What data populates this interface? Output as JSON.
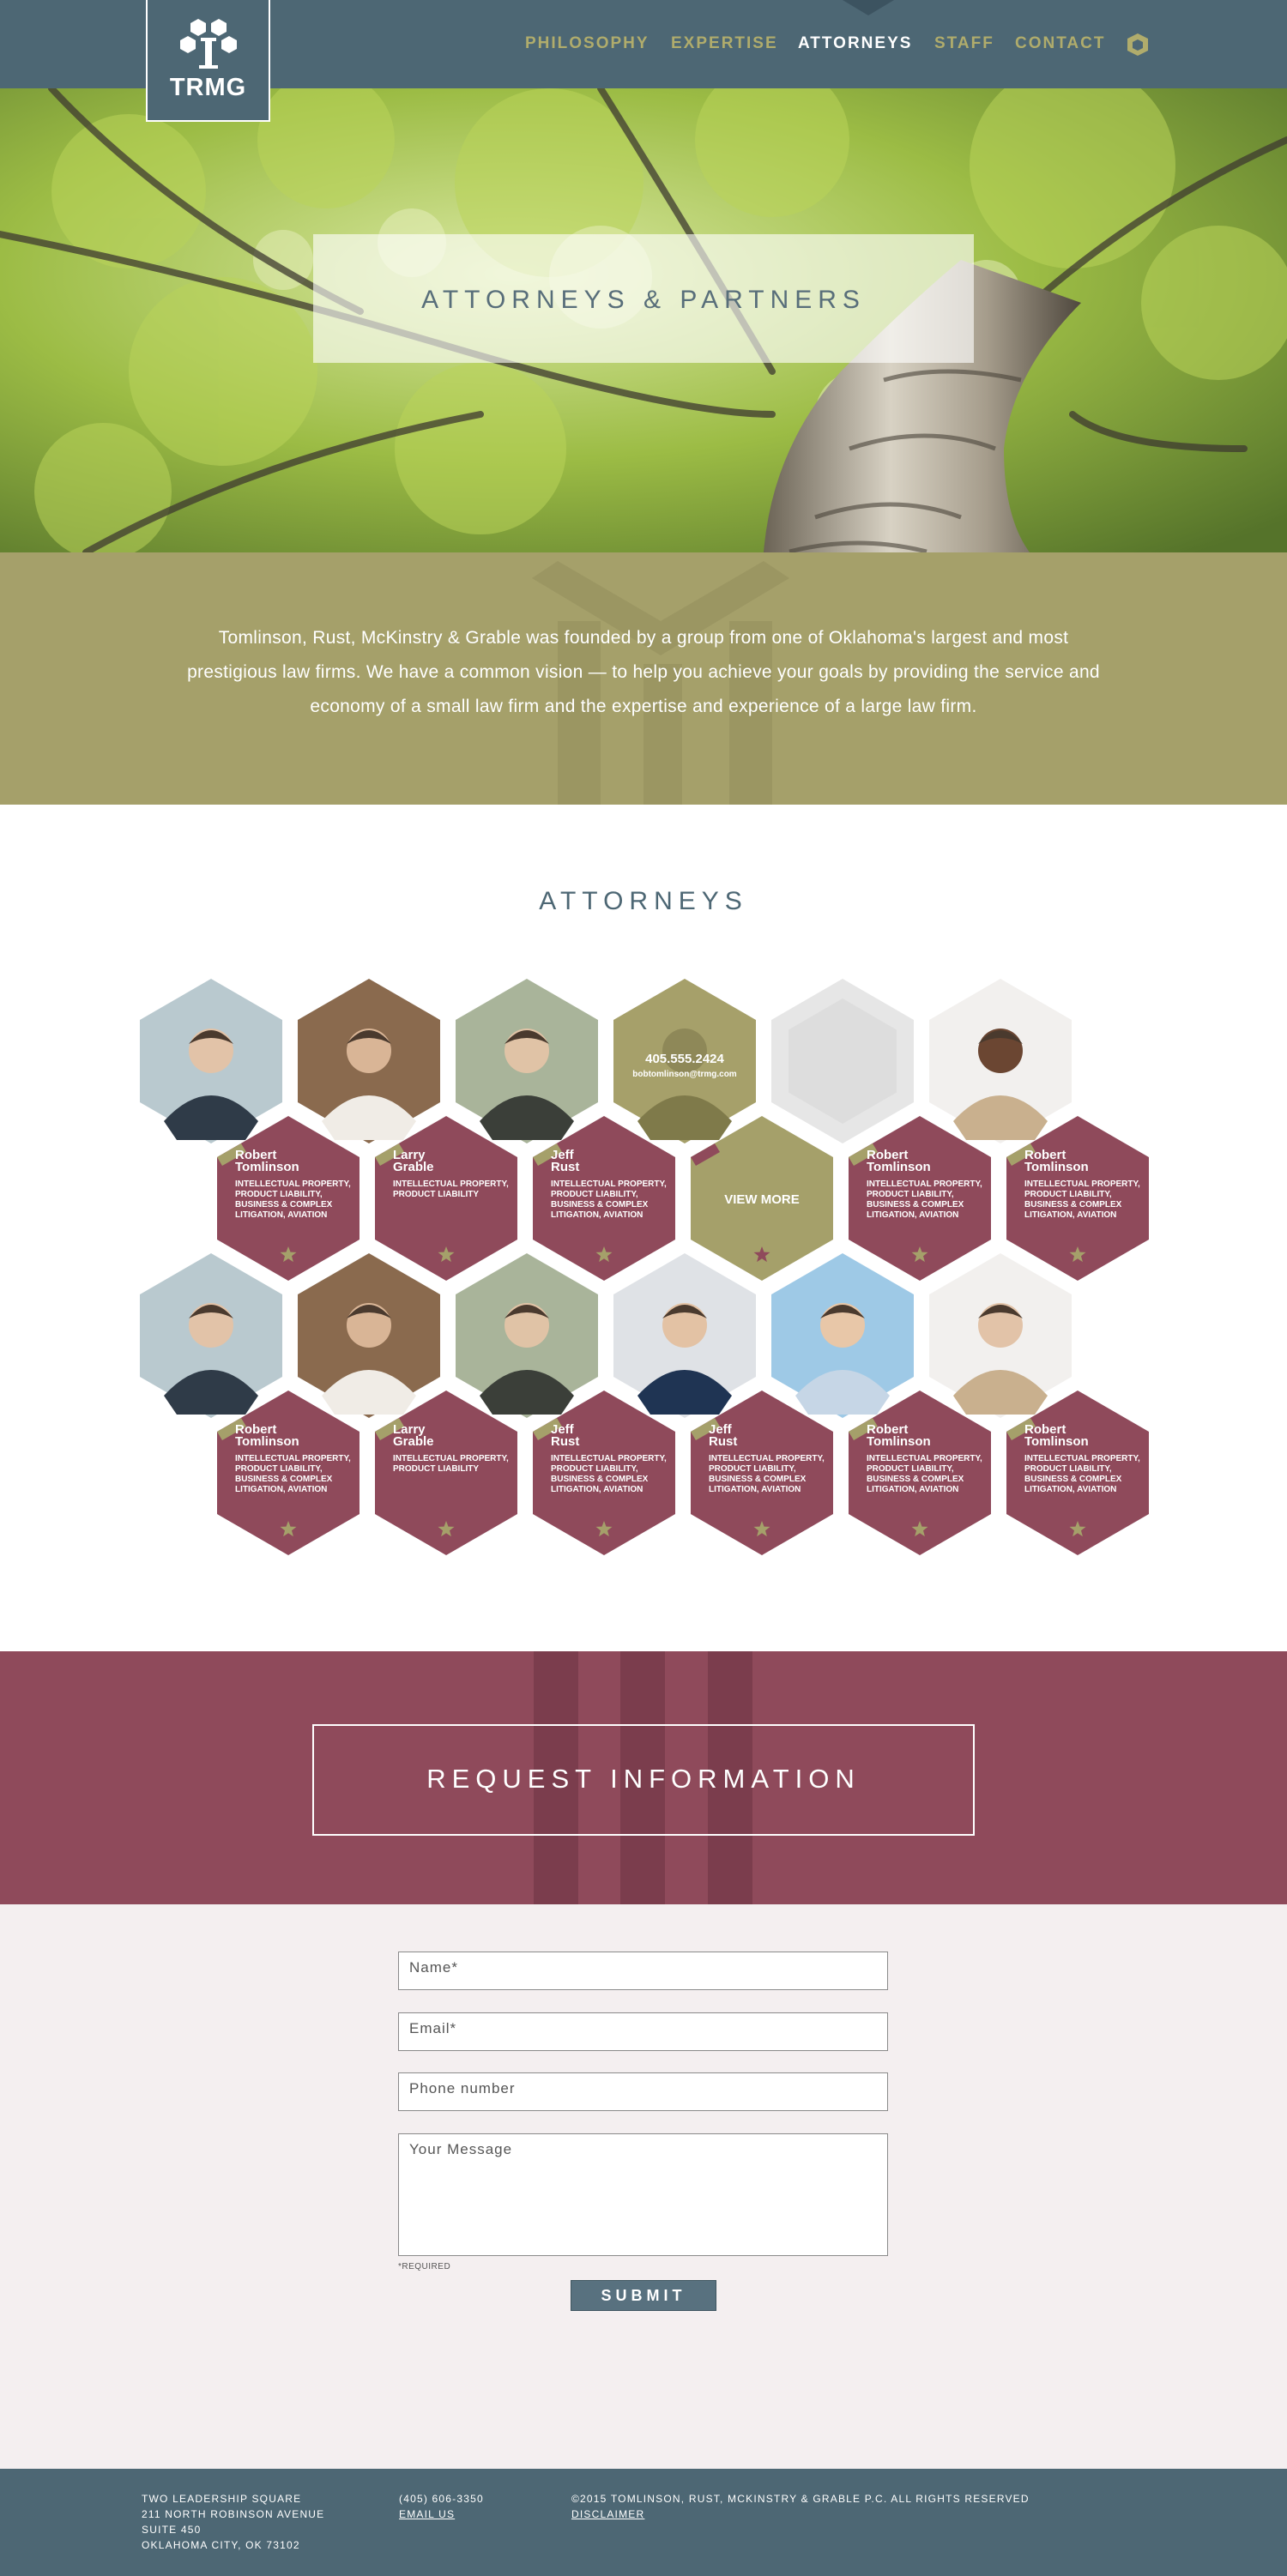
{
  "brand": {
    "logo_text": "TRMG"
  },
  "nav": {
    "items": [
      {
        "label": "PHILOSOPHY",
        "active": false
      },
      {
        "label": "EXPERTISE",
        "active": false
      },
      {
        "label": "ATTORNEYS",
        "active": true
      },
      {
        "label": "STAFF",
        "active": false
      },
      {
        "label": "CONTACT",
        "active": false
      }
    ],
    "icon": "shield-icon"
  },
  "hero": {
    "title": "ATTORNEYS & PARTNERS"
  },
  "intro": {
    "text": "Tomlinson, Rust, McKinstry & Grable was founded by a group from one of Oklahoma's largest and most prestigious law firms. We have a common vision — to help you achieve your goals by providing the service and economy of a small law firm and the expertise and experience of a large law firm."
  },
  "attorneys": {
    "title": "ATTORNEYS",
    "hover_phone": "405.555.2424",
    "hover_email": "bobtomlinson@trmg.com",
    "view_more": "VIEW MORE",
    "rows": [
      [
        {
          "first": "Robert",
          "last": "Tomlinson",
          "practice": [
            "INTELLECTUAL PROPERTY,",
            "PRODUCT LIABILITY,",
            "BUSINESS & COMPLEX",
            "LITIGATION, AVIATION"
          ]
        },
        {
          "first": "Larry",
          "last": "Grable",
          "practice": [
            "INTELLECTUAL PROPERTY,",
            "PRODUCT LIABILITY"
          ]
        },
        {
          "first": "Jeff",
          "last": "Rust",
          "practice": [
            "INTELLECTUAL PROPERTY,",
            "PRODUCT LIABILITY,",
            "BUSINESS & COMPLEX",
            "LITIGATION, AVIATION"
          ]
        },
        {
          "view_more": true
        },
        {
          "first": "Robert",
          "last": "Tomlinson",
          "practice": [
            "INTELLECTUAL PROPERTY,",
            "PRODUCT LIABILITY,",
            "BUSINESS & COMPLEX",
            "LITIGATION, AVIATION"
          ]
        },
        {
          "first": "Robert",
          "last": "Tomlinson",
          "practice": [
            "INTELLECTUAL PROPERTY,",
            "PRODUCT LIABILITY,",
            "BUSINESS & COMPLEX",
            "LITIGATION, AVIATION"
          ]
        }
      ],
      [
        {
          "first": "Robert",
          "last": "Tomlinson",
          "practice": [
            "INTELLECTUAL PROPERTY,",
            "PRODUCT LIABILITY,",
            "BUSINESS & COMPLEX",
            "LITIGATION, AVIATION"
          ]
        },
        {
          "first": "Larry",
          "last": "Grable",
          "practice": [
            "INTELLECTUAL PROPERTY,",
            "PRODUCT LIABILITY"
          ]
        },
        {
          "first": "Jeff",
          "last": "Rust",
          "practice": [
            "INTELLECTUAL PROPERTY,",
            "PRODUCT LIABILITY,",
            "BUSINESS & COMPLEX",
            "LITIGATION, AVIATION"
          ]
        },
        {
          "first": "Jeff",
          "last": "Rust",
          "practice": [
            "INTELLECTUAL PROPERTY,",
            "PRODUCT LIABILITY,",
            "BUSINESS & COMPLEX",
            "LITIGATION, AVIATION"
          ]
        },
        {
          "first": "Robert",
          "last": "Tomlinson",
          "practice": [
            "INTELLECTUAL PROPERTY,",
            "PRODUCT LIABILITY,",
            "BUSINESS & COMPLEX",
            "LITIGATION, AVIATION"
          ]
        },
        {
          "first": "Robert",
          "last": "Tomlinson",
          "practice": [
            "INTELLECTUAL PROPERTY,",
            "PRODUCT LIABILITY,",
            "BUSINESS & COMPLEX",
            "LITIGATION, AVIATION"
          ]
        }
      ]
    ]
  },
  "request": {
    "title": "REQUEST INFORMATION"
  },
  "form": {
    "name_placeholder": "Name*",
    "email_placeholder": "Email*",
    "phone_placeholder": "Phone number",
    "message_placeholder": "Your Message",
    "required_note": "*REQUIRED",
    "submit_label": "SUBMIT"
  },
  "footer": {
    "address": [
      "TWO LEADERSHIP SQUARE",
      "211 NORTH ROBINSON AVENUE",
      "SUITE 450",
      "OKLAHOMA CITY, OK 73102"
    ],
    "phone": "(405) 606-3350",
    "email_link": "EMAIL US",
    "copyright": "©2015 TOMLINSON, RUST, MCKINSTRY & GRABLE P.C. ALL RIGHTS RESERVED",
    "disclaimer_link": "DISCLAIMER"
  },
  "colors": {
    "slate": "#4d6774",
    "olive": "#a5a06a",
    "wine": "#8f4a5b",
    "gold_text": "#b0ac6c"
  }
}
